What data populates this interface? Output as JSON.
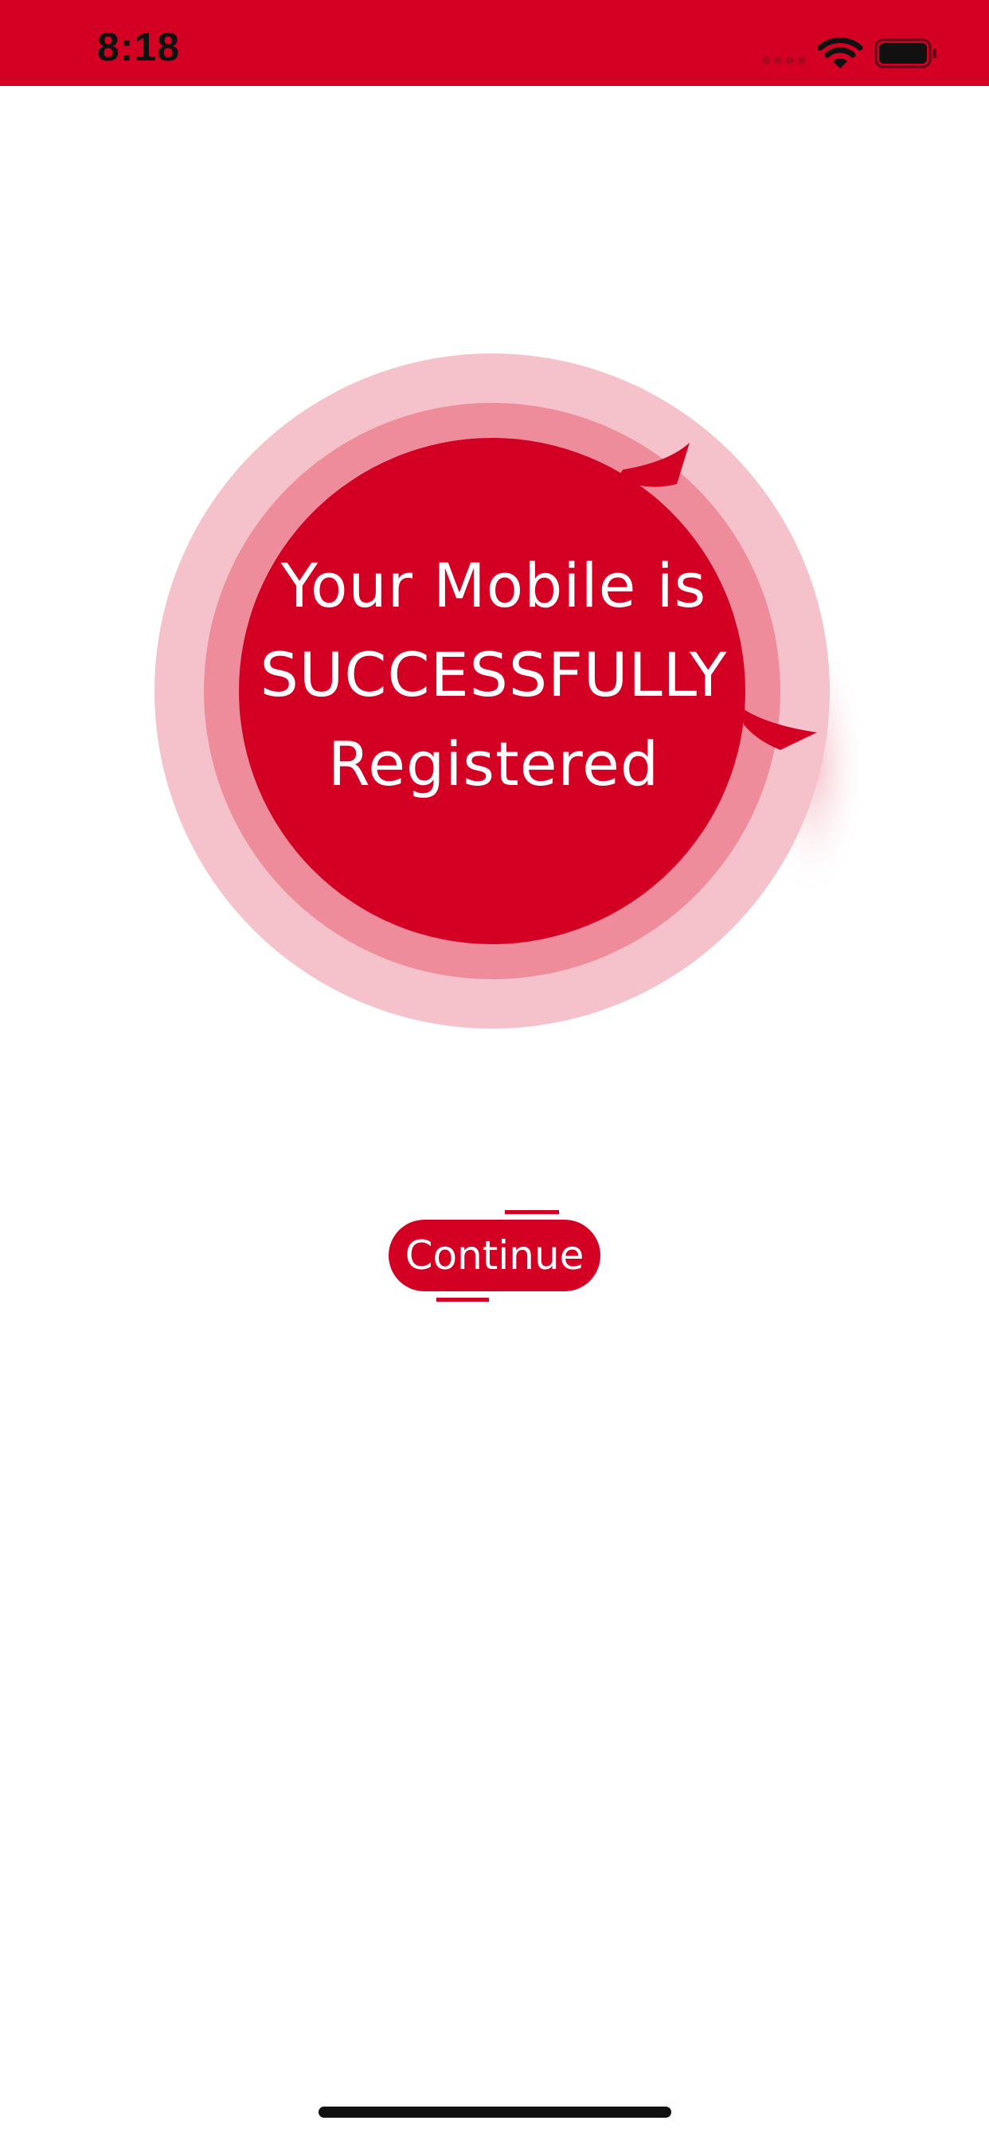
{
  "status_bar": {
    "time": "8:18",
    "icons": [
      "signal-icon",
      "wifi-icon",
      "battery-icon"
    ]
  },
  "success": {
    "line1": "Your Mobile is",
    "line2": "SUCCESSFULLY",
    "line3": "Registered"
  },
  "actions": {
    "continue_label": "Continue"
  },
  "colors": {
    "accent": "#d40023",
    "ring_outer": "#f5c2cb",
    "ring_middle": "#ee8c9c",
    "background": "#ffffff"
  }
}
